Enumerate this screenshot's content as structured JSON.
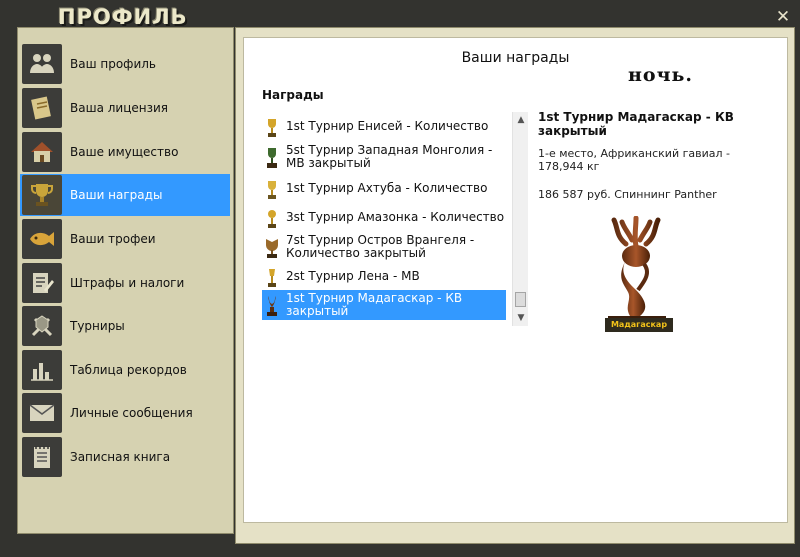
{
  "window": {
    "title": "ПРОФИЛЬ",
    "close_glyph": "✕"
  },
  "sidebar": {
    "items": [
      {
        "label": "Ваш профиль",
        "icon": "users-icon",
        "glyph": "👥"
      },
      {
        "label": "Ваша лицензия",
        "icon": "license-icon",
        "glyph": "📜"
      },
      {
        "label": "Ваше имущество",
        "icon": "house-icon",
        "glyph": "🏠"
      },
      {
        "label": "Ваши награды",
        "icon": "trophy-icon",
        "glyph": "🏆",
        "active": true
      },
      {
        "label": "Ваши трофеи",
        "icon": "fish-trophy-icon",
        "glyph": "🐟"
      },
      {
        "label": "Штрафы и налоги",
        "icon": "fines-icon",
        "glyph": "📝"
      },
      {
        "label": "Турниры",
        "icon": "tournament-icon",
        "glyph": "⚔"
      },
      {
        "label": "Таблица рекордов",
        "icon": "chart-icon",
        "glyph": "📊"
      },
      {
        "label": "Личные сообщения",
        "icon": "envelope-icon",
        "glyph": "✉"
      },
      {
        "label": "Записная книга",
        "icon": "notebook-icon",
        "glyph": "📓"
      }
    ]
  },
  "panel": {
    "title": "Ваши награды",
    "night_label": "ночь.",
    "section_label": "Награды"
  },
  "awards": [
    {
      "text": "1st Турнир Енисей - Количество",
      "trophy": "gold"
    },
    {
      "text": "5st Турнир Западная Монголия - МВ закрытый",
      "trophy": "green"
    },
    {
      "text": "1st Турнир Ахтуба - Количество",
      "trophy": "gold"
    },
    {
      "text": "3st Турнир Амазонка - Количество",
      "trophy": "gold"
    },
    {
      "text": "7st Турнир Остров Врангеля - Количество закрытый",
      "trophy": "bronze"
    },
    {
      "text": "2st Турнир Лена - МВ",
      "trophy": "gold"
    },
    {
      "text": "1st Турнир Мадагаскар - КВ закрытый",
      "trophy": "wood",
      "selected": true
    }
  ],
  "detail": {
    "title": "1st Турнир Мадагаскар - КВ закрытый",
    "line1": "1-е место, Африканский гавиал - 178,944 кг",
    "line2": "186 587 руб. Спиннинг Panther",
    "image_caption": "Мадагаскар"
  },
  "colors": {
    "accent": "#3399ff",
    "sidebar_bg": "#d6d2b1",
    "frame_bg": "#33332f"
  }
}
